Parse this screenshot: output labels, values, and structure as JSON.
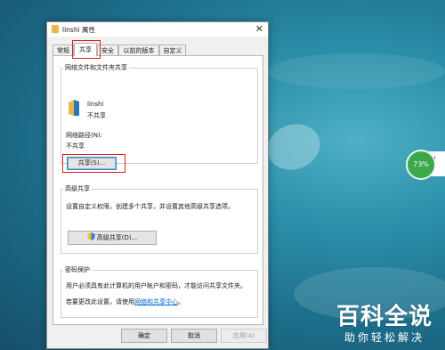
{
  "window": {
    "title": "linshi 属性",
    "close_glyph": "✕"
  },
  "tabs": [
    {
      "label": "常规"
    },
    {
      "label": "共享",
      "active": true
    },
    {
      "label": "安全"
    },
    {
      "label": "以前的版本"
    },
    {
      "label": "自定义"
    }
  ],
  "network_sharing": {
    "group_label": "网络文件和文件夹共享",
    "folder_name": "linshi",
    "folder_status": "不共享",
    "path_label": "网络路径(N):",
    "path_value": "不共享",
    "share_button": "共享(S)..."
  },
  "advanced_sharing": {
    "group_label": "高级共享",
    "description": "设置自定义权限，创建多个共享，并设置其他高级共享选项。",
    "button": "高级共享(D)..."
  },
  "password_protection": {
    "group_label": "密码保护",
    "description": "用户必须具有此计算机的用户帐户和密码，才能访问共享文件夹。",
    "change_prefix": "若要更改此设置，请使用",
    "change_link": "网络和共享中心",
    "change_suffix": "。"
  },
  "footer": {
    "ok": "确定",
    "cancel": "取消",
    "apply": "应用(A)"
  },
  "widget": {
    "percent": "73%"
  },
  "watermark": {
    "main": "百科全说",
    "sub": "助你轻松解决"
  }
}
